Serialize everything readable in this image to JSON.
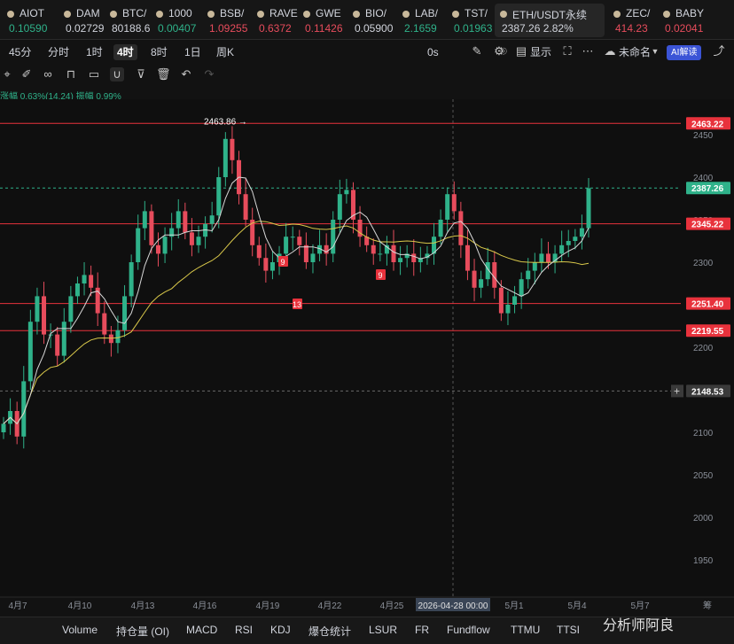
{
  "tickers": [
    {
      "sym": "AIOT",
      "price": "0.10590",
      "color": "#2fb28a"
    },
    {
      "sym": "DAM",
      "price": "0.02729",
      "color": "#d1d4dc"
    },
    {
      "sym": "BTC/",
      "price": "80188.6",
      "color": "#d1d4dc"
    },
    {
      "sym": "1000",
      "price": "0.00407",
      "color": "#2fb28a"
    },
    {
      "sym": "BSB/",
      "price": "1.09255",
      "color": "#e74c5c"
    },
    {
      "sym": "RAVE",
      "price": "0.6372",
      "color": "#e74c5c"
    },
    {
      "sym": "GWE",
      "price": "0.11426",
      "color": "#e74c5c"
    },
    {
      "sym": "BIO/",
      "price": "0.05900",
      "color": "#d1d4dc"
    },
    {
      "sym": "LAB/",
      "price": "2.1659",
      "color": "#2fb28a"
    },
    {
      "sym": "TST/",
      "price": "0.01963",
      "color": "#2fb28a"
    },
    {
      "sym": "ETH/USDT永续",
      "price": "2387.26  2.82%",
      "color": "#d1d4dc"
    },
    {
      "sym": "ZEC/",
      "price": "414.23",
      "color": "#e74c5c"
    },
    {
      "sym": "BABY",
      "price": "0.02041",
      "color": "#e74c5c"
    }
  ],
  "timeframes": [
    "45分",
    "分时",
    "1时",
    "4时",
    "8时",
    "1日",
    "周K"
  ],
  "selected_timeframe": "4时",
  "toolbar": {
    "replay": "0s",
    "display": "显示",
    "layout_name": "未命名",
    "ai": "AI解读"
  },
  "stats": "涨幅 0.63%(14.24)  振幅 0.99%",
  "bottom_indicators": [
    "Volume",
    "持仓量 (OI)",
    "MACD",
    "RSI",
    "KDJ",
    "爆仓统计",
    "LSUR",
    "FR",
    "Fundflow",
    "TTMU",
    "TTSI"
  ],
  "watermark": "分析师阿良",
  "colors": {
    "up": "#2fb28a",
    "down": "#e74c5c",
    "ma_short": "#d8d8d8",
    "ma_long": "#d9c84a",
    "level_line": "#e8323c"
  },
  "chart_data": {
    "type": "candlestick",
    "symbol": "ETH/USDT永续",
    "interval": "4时",
    "x_ticks": [
      "4月7",
      "4月10",
      "4月13",
      "4月16",
      "4月19",
      "4月22",
      "4月25",
      "2026-04-28 00:00",
      "5月1",
      "5月4",
      "5月7",
      "筹"
    ],
    "y_ticks": [
      2450,
      2400,
      2350,
      2300,
      2250,
      2200,
      2150,
      2100,
      2050,
      2000,
      1950
    ],
    "ylim": [
      1900,
      2500
    ],
    "price_levels": [
      {
        "label": "2463.22",
        "value": 2463.22,
        "color": "#e8323c"
      },
      {
        "label": "2387.26",
        "value": 2387.26,
        "color": "#2fb28a"
      },
      {
        "label": "2345.22",
        "value": 2345.22,
        "color": "#e8323c"
      },
      {
        "label": "2251.40",
        "value": 2251.4,
        "color": "#e8323c"
      },
      {
        "label": "2219.55",
        "value": 2219.55,
        "color": "#e8323c"
      },
      {
        "label": "2148.53",
        "value": 2148.53,
        "color": "#555555"
      }
    ],
    "high_marker": "2463.86 →",
    "markers": [
      {
        "text": "9"
      },
      {
        "text": "13"
      },
      {
        "text": "9"
      }
    ],
    "close_path": [
      2110,
      2125,
      2095,
      2160,
      2230,
      2260,
      2215,
      2215,
      2190,
      2230,
      2260,
      2275,
      2285,
      2270,
      2240,
      2215,
      2205,
      2220,
      2260,
      2300,
      2340,
      2360,
      2320,
      2310,
      2330,
      2340,
      2360,
      2335,
      2320,
      2330,
      2345,
      2355,
      2400,
      2445,
      2420,
      2380,
      2350,
      2320,
      2305,
      2290,
      2300,
      2310,
      2330,
      2330,
      2320,
      2300,
      2310,
      2320,
      2310,
      2350,
      2380,
      2385,
      2350,
      2330,
      2320,
      2310,
      2310,
      2320,
      2300,
      2305,
      2310,
      2300,
      2305,
      2310,
      2330,
      2350,
      2380,
      2360,
      2320,
      2290,
      2270,
      2280,
      2300,
      2270,
      2240,
      2250,
      2260,
      2280,
      2290,
      2300,
      2310,
      2300,
      2310,
      2320,
      2325,
      2330,
      2340,
      2387
    ]
  }
}
